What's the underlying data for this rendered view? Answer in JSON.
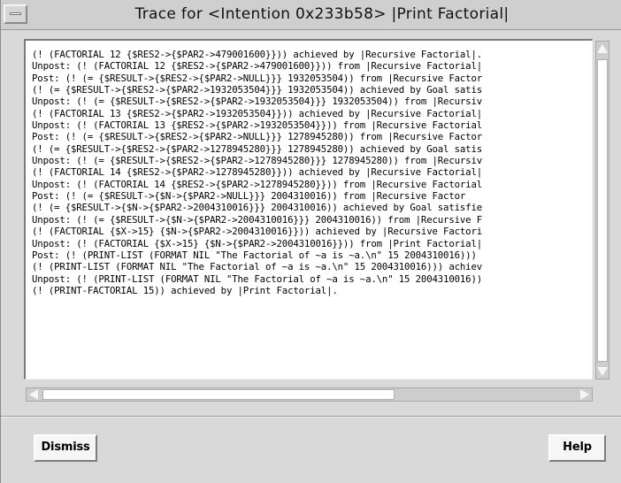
{
  "window": {
    "title": "Trace for <Intention 0x233b58> |Print Factorial|"
  },
  "trace": {
    "lines": [
      "(! (FACTORIAL 12 {$RES2->{$PAR2->479001600}})) achieved by |Recursive Factorial|.",
      "Unpost: (! (FACTORIAL 12 {$RES2->{$PAR2->479001600}})) from |Recursive Factorial|",
      "Post: (! (= {$RESULT->{$RES2->{$PAR2->NULL}}} 1932053504)) from |Recursive Factor",
      "(! (= {$RESULT->{$RES2->{$PAR2->1932053504}}} 1932053504)) achieved by Goal satis",
      "Unpost: (! (= {$RESULT->{$RES2->{$PAR2->1932053504}}} 1932053504)) from |Recursiv",
      "(! (FACTORIAL 13 {$RES2->{$PAR2->1932053504}})) achieved by |Recursive Factorial|",
      "Unpost: (! (FACTORIAL 13 {$RES2->{$PAR2->1932053504}})) from |Recursive Factorial",
      "Post: (! (= {$RESULT->{$RES2->{$PAR2->NULL}}} 1278945280)) from |Recursive Factor",
      "(! (= {$RESULT->{$RES2->{$PAR2->1278945280}}} 1278945280)) achieved by Goal satis",
      "Unpost: (! (= {$RESULT->{$RES2->{$PAR2->1278945280}}} 1278945280)) from |Recursiv",
      "(! (FACTORIAL 14 {$RES2->{$PAR2->1278945280}})) achieved by |Recursive Factorial|",
      "Unpost: (! (FACTORIAL 14 {$RES2->{$PAR2->1278945280}})) from |Recursive Factorial",
      "Post: (! (= {$RESULT->{$N->{$PAR2->NULL}}} 2004310016)) from |Recursive Factor",
      "(! (= {$RESULT->{$N->{$PAR2->2004310016}}} 2004310016)) achieved by Goal satisfie",
      "Unpost: (! (= {$RESULT->{$N->{$PAR2->2004310016}}} 2004310016)) from |Recursive F",
      "(! (FACTORIAL {$X->15} {$N->{$PAR2->2004310016}})) achieved by |Recursive Factori",
      "Unpost: (! (FACTORIAL {$X->15} {$N->{$PAR2->2004310016}})) from |Print Factorial|",
      "Post: (! (PRINT-LIST (FORMAT NIL \"The Factorial of ~a is ~a.\\n\" 15 2004310016)))",
      "(! (PRINT-LIST (FORMAT NIL \"The Factorial of ~a is ~a.\\n\" 15 2004310016))) achiev",
      "Unpost: (! (PRINT-LIST (FORMAT NIL \"The Factorial of ~a is ~a.\\n\" 15 2004310016))",
      "(! (PRINT-FACTORIAL 15)) achieved by |Print Factorial|."
    ]
  },
  "buttons": {
    "dismiss_label": "Dismiss",
    "help_label": "Help"
  }
}
